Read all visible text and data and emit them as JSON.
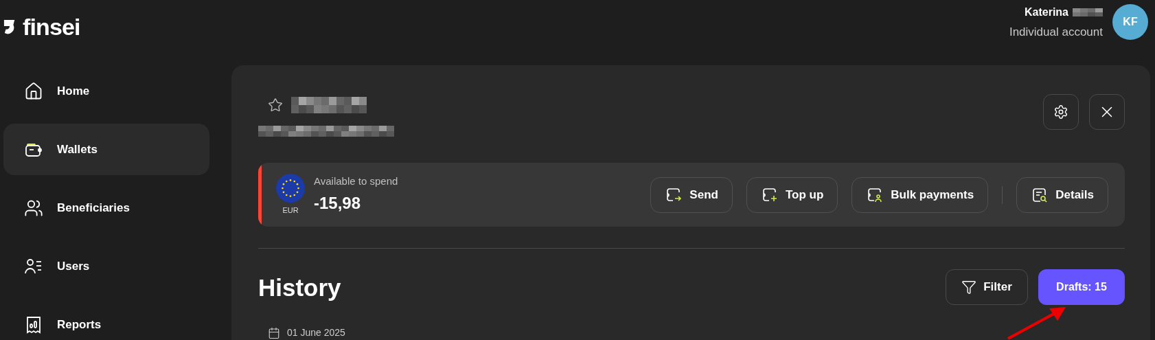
{
  "brand": {
    "name": "finsei"
  },
  "user": {
    "name": "Katerina",
    "account": "Individual account",
    "initials": "KF"
  },
  "sidebar": {
    "items": [
      {
        "label": "Home",
        "kind": "home",
        "selected": false
      },
      {
        "label": "Wallets",
        "kind": "wallet",
        "selected": true
      },
      {
        "label": "Beneficiaries",
        "kind": "people",
        "selected": false
      },
      {
        "label": "Users",
        "kind": "users",
        "selected": false
      },
      {
        "label": "Reports",
        "kind": "reports",
        "selected": false
      }
    ]
  },
  "wallet": {
    "currency": "EUR",
    "balance_label": "Available to spend",
    "balance": "-15,98",
    "negative": true,
    "actions": [
      {
        "label": "Send",
        "kind": "send"
      },
      {
        "label": "Top up",
        "kind": "topup"
      },
      {
        "label": "Bulk payments",
        "kind": "bulk"
      },
      {
        "label": "Details",
        "kind": "details"
      }
    ]
  },
  "history": {
    "title": "History",
    "filter": "Filter",
    "drafts": "Drafts: 15",
    "date": "01 June 2025"
  }
}
